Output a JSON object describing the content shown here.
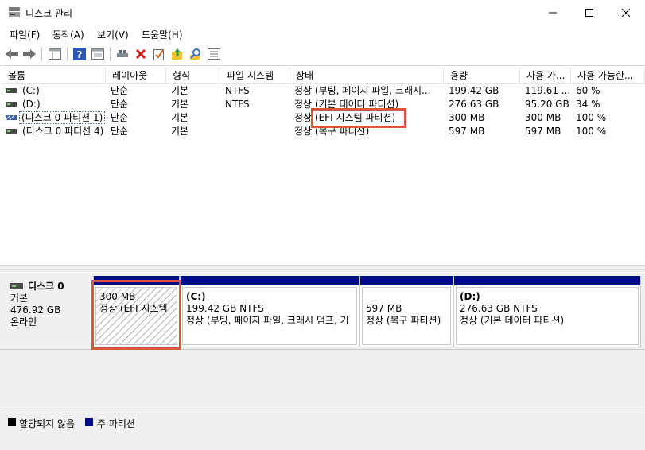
{
  "window": {
    "title": "디스크 관리",
    "controls": {
      "minimize": "—",
      "maximize": "☐",
      "close": "✕"
    }
  },
  "menu": [
    "파일(F)",
    "동작(A)",
    "보기(V)",
    "도움말(H)"
  ],
  "toolbar": {
    "icons": [
      "back-arrow-icon",
      "forward-arrow-icon",
      "console-tree-icon",
      "help-icon",
      "properties-icon",
      "connect-icon",
      "delete-icon",
      "check-icon",
      "folder-up-icon",
      "search-disk-icon",
      "list-icon"
    ]
  },
  "list": {
    "columns": [
      "볼륨",
      "레이아웃",
      "형식",
      "파일 시스템",
      "상태",
      "용량",
      "사용 가...",
      "사용 가능한..."
    ],
    "rows": [
      {
        "volume": "(C:)",
        "layout": "단순",
        "type": "기본",
        "fs": "NTFS",
        "status": "정상 (부팅, 페이지 파일, 크래시...",
        "capacity": "199.42 GB",
        "free": "119.61 ...",
        "free_pct": "60 %"
      },
      {
        "volume": "(D:)",
        "layout": "단순",
        "type": "기본",
        "fs": "NTFS",
        "status": "정상 (기본 데이터 파티션)",
        "capacity": "276.63 GB",
        "free": "95.20 GB",
        "free_pct": "34 %"
      },
      {
        "volume": "(디스크 0 파티션 1)",
        "layout": "단순",
        "type": "기본",
        "fs": "",
        "status": "정상 (EFI 시스템 파티션)",
        "capacity": "300 MB",
        "free": "300 MB",
        "free_pct": "100 %"
      },
      {
        "volume": "(디스크 0 파티션 4)",
        "layout": "단순",
        "type": "기본",
        "fs": "",
        "status": "정상 (복구 파티션)",
        "capacity": "597 MB",
        "free": "597 MB",
        "free_pct": "100 %"
      }
    ],
    "status_prefix": "정상",
    "status_efi_highlight": "(EFI 시스템 파티션)"
  },
  "disk": {
    "name": "디스크 0",
    "type": "기본",
    "size": "476.92 GB",
    "state": "온라인",
    "partitions": [
      {
        "label": "",
        "size": "300 MB",
        "status": "정상 (EFI 시스템"
      },
      {
        "label": "(C:)",
        "size": "199.42 GB NTFS",
        "status": "정상 (부팅, 페이지 파일, 크래시 덤프, 기"
      },
      {
        "label": "",
        "size": "597 MB",
        "status": "정상 (복구 파티션)"
      },
      {
        "label": "(D:)",
        "size": "276.63 GB NTFS",
        "status": "정상 (기본 데이터 파티션)"
      }
    ]
  },
  "legend": [
    {
      "label": "할당되지 않음",
      "color": "#000000"
    },
    {
      "label": "주 파티션",
      "color": "#000b87"
    }
  ],
  "colors": {
    "primary_partition": "#000b87",
    "highlight_box": "#d9553c"
  }
}
